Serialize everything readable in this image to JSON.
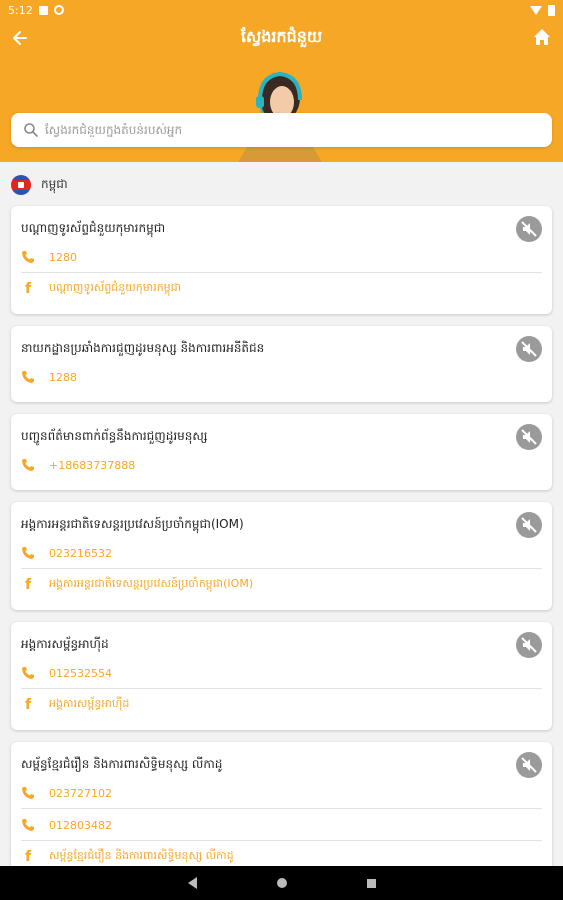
{
  "status": {
    "time": "5:12"
  },
  "header": {
    "title": "ស្វែងរកជំនួយ"
  },
  "search": {
    "placeholder": "ស្វែងរកជំនួយក្នុងតំបន់របស់អ្នក"
  },
  "country": {
    "name": "កម្ពុជា"
  },
  "cards": [
    {
      "name": "បណ្ដាញទូរស័ព្ទជំនួយកុមារកម្ពុជា",
      "rows": [
        {
          "type": "phone",
          "text": "1280"
        },
        {
          "type": "facebook",
          "text": "បណ្ដាញទូរស័ព្ទជំនួយកុមារកម្ពុជា"
        }
      ]
    },
    {
      "name": "នាយកដ្ឋានប្រឆាំងការជួញដូរមនុស្ស និងការពារអនីតិជន",
      "rows": [
        {
          "type": "phone",
          "text": "1288"
        }
      ]
    },
    {
      "name": "បញ្ជូនព័ត៌មានពាក់ព័ន្ធនឹងការជួញដូរមនុស្ស",
      "rows": [
        {
          "type": "phone",
          "text": "+18683737888"
        }
      ]
    },
    {
      "name": "អង្គការអន្តរជាតិទេសន្តរប្រវេសន៍ប្រចាំកម្ពុជា(IOM)",
      "rows": [
        {
          "type": "phone",
          "text": "023216532"
        },
        {
          "type": "facebook",
          "text": "អង្គការអន្តរជាតិទេសន្តរប្រវេសន៍ប្រចាំកម្ពុជា(IOM)"
        }
      ]
    },
    {
      "name": "អង្គការសម្ព័ន្ធអាហ៊ីដ",
      "rows": [
        {
          "type": "phone",
          "text": "012532554"
        },
        {
          "type": "facebook",
          "text": "អង្គការសម្ព័ន្ធអាហ៊ីដ"
        }
      ]
    },
    {
      "name": "សម្ព័ន្ធខ្មែរជំរឿន និងការពារសិទ្ធិមនុស្ស លីកាដូ",
      "rows": [
        {
          "type": "phone",
          "text": "023727102"
        },
        {
          "type": "phone",
          "text": "012803482"
        },
        {
          "type": "facebook",
          "text": "សម្ព័ន្ធខ្មែរជំរឿន និងការពារសិទ្ធិមនុស្ស លីកាដូ"
        }
      ]
    }
  ],
  "colors": {
    "accent": "#f7a726",
    "mute": "#9a9a9a"
  }
}
